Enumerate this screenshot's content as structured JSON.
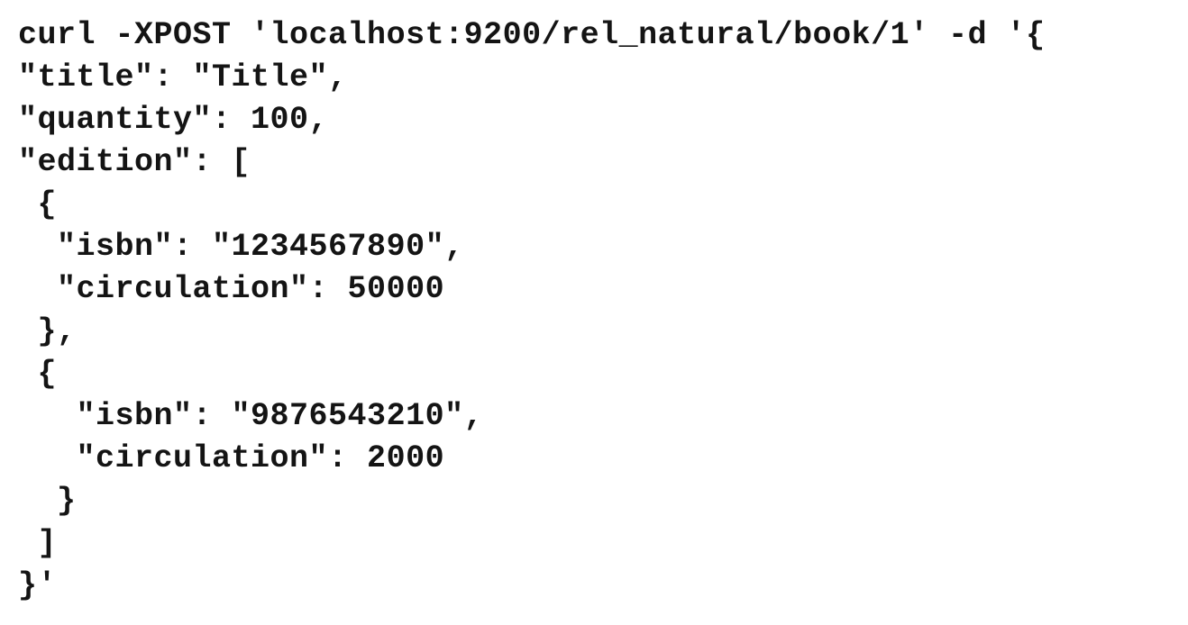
{
  "code": {
    "lines": [
      "curl -XPOST 'localhost:9200/rel_natural/book/1' -d '{",
      "\"title\": \"Title\",",
      "\"quantity\": 100,",
      "\"edition\": [",
      " {",
      "  \"isbn\": \"1234567890\",",
      "  \"circulation\": 50000",
      " },",
      " {",
      "   \"isbn\": \"9876543210\",",
      "   \"circulation\": 2000",
      "  }",
      " ]",
      "}'"
    ]
  }
}
